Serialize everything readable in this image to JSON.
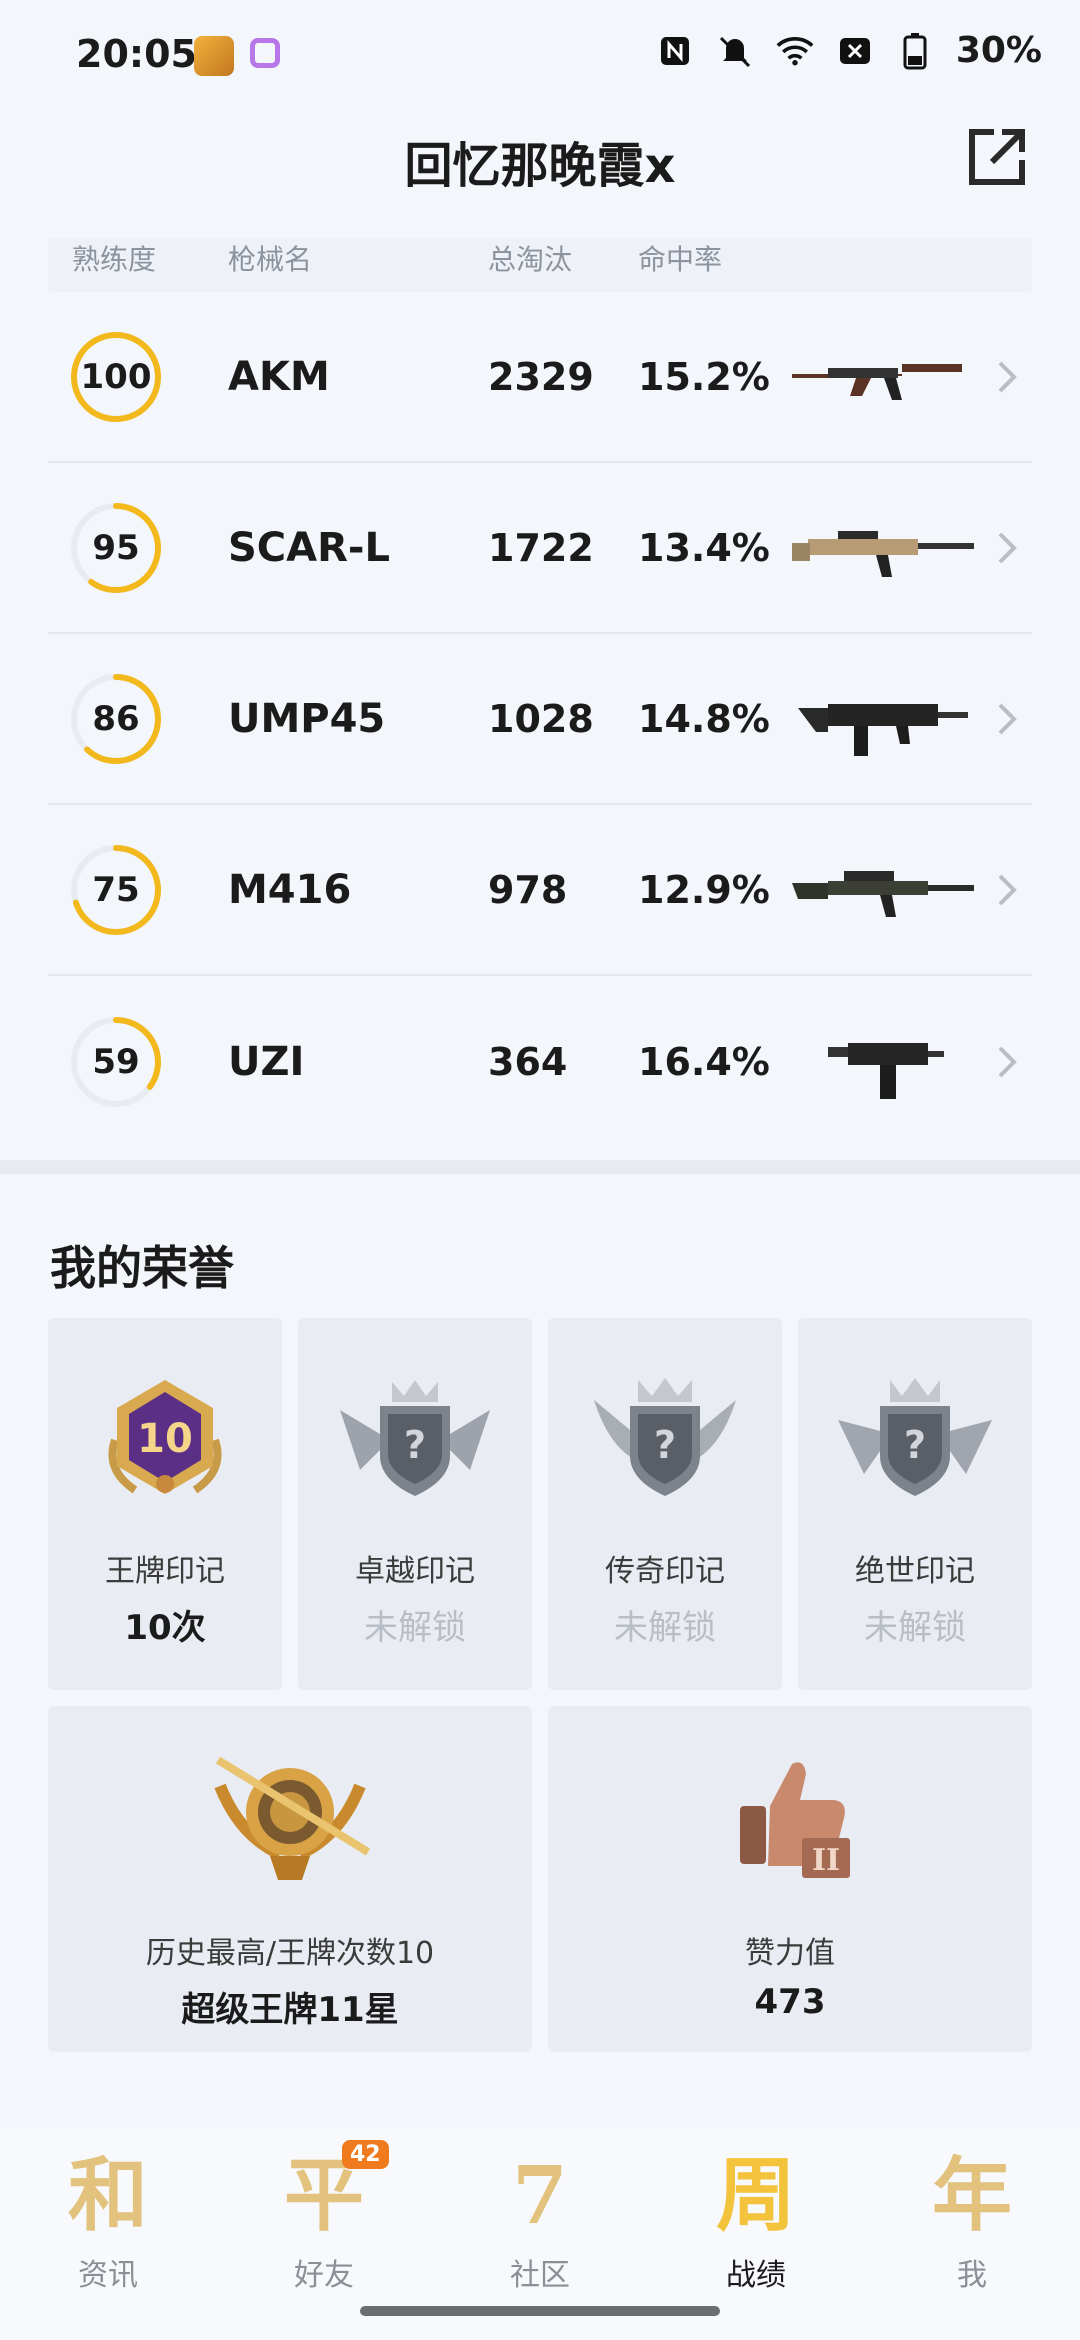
{
  "status_bar": {
    "time": "20:05",
    "battery": "30%",
    "icons": [
      "nfc-icon",
      "mute-icon",
      "wifi-icon",
      "sim-off-icon",
      "battery-icon"
    ]
  },
  "header": {
    "title": "回忆那晚霞x",
    "share_icon": "share-external-icon"
  },
  "weapon_table": {
    "headers": {
      "proficiency": "熟练度",
      "gun_name": "枪械名",
      "total_kills": "总淘汰",
      "hit_rate": "命中率"
    },
    "rows": [
      {
        "proficiency": "100",
        "progress": 1.0,
        "name": "AKM",
        "kills": "2329",
        "rate": "15.2%",
        "gun_icon": "akm-rifle-icon"
      },
      {
        "proficiency": "95",
        "progress": 0.6,
        "name": "SCAR-L",
        "kills": "1722",
        "rate": "13.4%",
        "gun_icon": "scar-rifle-icon"
      },
      {
        "proficiency": "86",
        "progress": 0.62,
        "name": "UMP45",
        "kills": "1028",
        "rate": "14.8%",
        "gun_icon": "ump45-smg-icon"
      },
      {
        "proficiency": "75",
        "progress": 0.7,
        "name": "M416",
        "kills": "978",
        "rate": "12.9%",
        "gun_icon": "m416-rifle-icon"
      },
      {
        "proficiency": "59",
        "progress": 0.35,
        "name": "UZI",
        "kills": "364",
        "rate": "16.4%",
        "gun_icon": "uzi-smg-icon"
      }
    ],
    "ring_color": "#f2b81c",
    "ring_track": "#e8ebf0"
  },
  "honors": {
    "title": "我的荣誉",
    "badges": [
      {
        "label": "王牌印记",
        "value": "10次",
        "locked": false,
        "badge_text": "10",
        "icon": "ace-mark-badge-icon"
      },
      {
        "label": "卓越印记",
        "value": "未解锁",
        "locked": true,
        "icon": "locked-badge-icon"
      },
      {
        "label": "传奇印记",
        "value": "未解锁",
        "locked": true,
        "icon": "locked-badge-icon"
      },
      {
        "label": "绝世印记",
        "value": "未解锁",
        "locked": true,
        "icon": "locked-badge-icon"
      }
    ],
    "wide": [
      {
        "label": "历史最高/王牌次数10",
        "value": "超级王牌11星",
        "icon": "super-ace-badge-icon"
      },
      {
        "label": "赞力值",
        "value": "473",
        "icon": "thumbs-up-badge-icon"
      }
    ]
  },
  "bottom_nav": {
    "items": [
      {
        "glyph": "和",
        "label": "资讯",
        "active": false
      },
      {
        "glyph": "平",
        "label": "好友",
        "active": false,
        "badge": "42"
      },
      {
        "glyph": "7",
        "label": "社区",
        "active": false
      },
      {
        "glyph": "周",
        "label": "战绩",
        "active": true
      },
      {
        "glyph": "年",
        "label": "我",
        "active": false
      }
    ]
  },
  "colors": {
    "accent_gold": "#f2b81c",
    "nav_glyph": "#e2c27c",
    "badge_orange": "#f07b1f"
  }
}
